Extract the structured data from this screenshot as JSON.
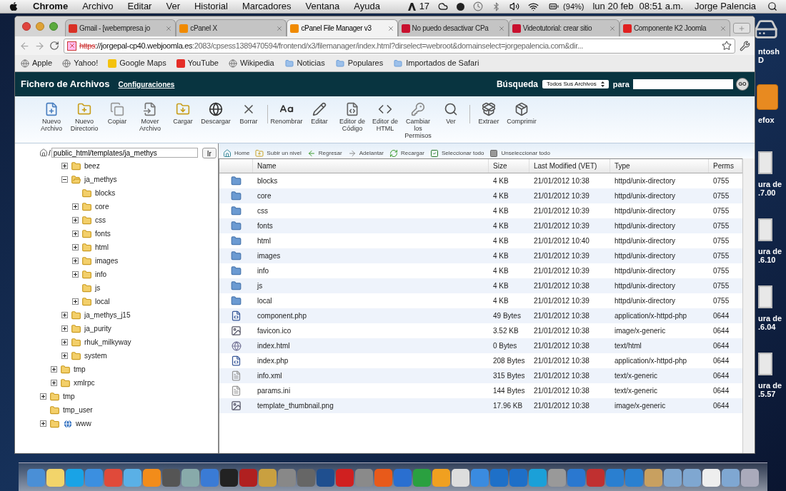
{
  "menubar": {
    "app": "Chrome",
    "menus": [
      "Archivo",
      "Editar",
      "Ver",
      "Historial",
      "Marcadores",
      "Ventana",
      "Ayuda"
    ],
    "adobe_count": "17",
    "battery": "(94%)",
    "date": "lun 20 feb",
    "time": "08:51 a.m.",
    "user": "Jorge Palencia"
  },
  "tabs": [
    {
      "title": "Gmail - [webempresa jo",
      "selected": false,
      "color": "#d93025"
    },
    {
      "title": "cPanel X",
      "selected": false,
      "color": "#f08a00"
    },
    {
      "title": "cPanel File Manager v3",
      "selected": true,
      "color": "#f08a00"
    },
    {
      "title": "No puedo desactivar CPa",
      "selected": false,
      "color": "#c8102e"
    },
    {
      "title": "Videotutorial: crear sitio",
      "selected": false,
      "color": "#c8102e"
    },
    {
      "title": "Componente K2 Joomla",
      "selected": false,
      "color": "#e02020"
    }
  ],
  "address": {
    "scheme": "https",
    "host": "://jorgepal-cp40.webjoomla.es",
    "path": ":2083/cpsess1389470594/frontend/x3/filemanager/index.html?dirselect=webroot&domainselect=jorgepalencia.com&dir..."
  },
  "bookmarks": [
    {
      "label": "Apple",
      "kind": "site"
    },
    {
      "label": "Yahoo!",
      "kind": "site"
    },
    {
      "label": "Google Maps",
      "kind": "app",
      "color": "#f4c20d"
    },
    {
      "label": "YouTube",
      "kind": "app",
      "color": "#e52d27"
    },
    {
      "label": "Wikipedia",
      "kind": "site"
    },
    {
      "label": "Noticias",
      "kind": "folder"
    },
    {
      "label": "Populares",
      "kind": "folder"
    },
    {
      "label": "Importados de Safari",
      "kind": "folder"
    }
  ],
  "header": {
    "title": "Fichero de Archivos",
    "settings_link": "Configuraciones",
    "search_label": "Búsqueda",
    "search_scope": "Todos Sus Archivos",
    "for_label": "para",
    "go": "GO"
  },
  "toolbar": [
    [
      "Nuevo Archivo",
      "Nuevo Directorio",
      "Copiar",
      "Mover Archivo",
      "Cargar",
      "Descargar",
      "Borrar"
    ],
    [
      "Renombrar",
      "Editar",
      "Editor de Código",
      "Editor de HTML",
      "Cambiar los Permisos",
      "Ver"
    ],
    [
      "Extraer",
      "Comprimir"
    ]
  ],
  "path": {
    "root": "/",
    "value": "public_html/templates/ja_methys",
    "go": "Ir"
  },
  "tree": [
    {
      "children": [
        {
          "children": [
            {
              "name": "beez",
              "expandable": true,
              "expanded": false,
              "kind": "folder"
            },
            {
              "name": "ja_methys",
              "expandable": true,
              "expanded": true,
              "kind": "folder",
              "children": [
                {
                  "name": "blocks",
                  "expandable": false,
                  "expanded": false,
                  "kind": "folder"
                },
                {
                  "name": "core",
                  "expandable": true,
                  "expanded": false,
                  "kind": "folder"
                },
                {
                  "name": "css",
                  "expandable": true,
                  "expanded": false,
                  "kind": "folder"
                },
                {
                  "name": "fonts",
                  "expandable": true,
                  "expanded": false,
                  "kind": "folder"
                },
                {
                  "name": "html",
                  "expandable": true,
                  "expanded": false,
                  "kind": "folder"
                },
                {
                  "name": "images",
                  "expandable": true,
                  "expanded": false,
                  "kind": "folder"
                },
                {
                  "name": "info",
                  "expandable": true,
                  "expanded": false,
                  "kind": "folder"
                },
                {
                  "name": "js",
                  "expandable": false,
                  "expanded": false,
                  "kind": "folder"
                },
                {
                  "name": "local",
                  "expandable": true,
                  "expanded": false,
                  "kind": "folder"
                }
              ]
            },
            {
              "name": "ja_methys_j15",
              "expandable": true,
              "expanded": false,
              "kind": "folder"
            },
            {
              "name": "ja_purity",
              "expandable": true,
              "expanded": false,
              "kind": "folder"
            },
            {
              "name": "rhuk_milkyway",
              "expandable": true,
              "expanded": false,
              "kind": "folder"
            },
            {
              "name": "system",
              "expandable": true,
              "expanded": false,
              "kind": "folder"
            }
          ]
        },
        {
          "name": "tmp",
          "expandable": true,
          "expanded": false,
          "kind": "folder"
        },
        {
          "name": "xmlrpc",
          "expandable": true,
          "expanded": false,
          "kind": "folder"
        }
      ]
    },
    {
      "name": "tmp",
      "expandable": true,
      "expanded": false,
      "kind": "folder"
    },
    {
      "name": "tmp_user",
      "expandable": false,
      "expanded": false,
      "kind": "folder"
    },
    {
      "name": "www",
      "expandable": true,
      "expanded": false,
      "kind": "web"
    }
  ],
  "navbar": [
    "Home",
    "Subir un nivel",
    "Regresar",
    "Adelantar",
    "Recargar",
    "Seleccionar todo",
    "Unseleccionar todo"
  ],
  "table": {
    "columns": [
      "Name",
      "Size",
      "Last Modified (VET)",
      "Type",
      "Perms"
    ],
    "rows": [
      {
        "kind": "folder",
        "name": "blocks",
        "size": "4 KB",
        "modified": "21/01/2012 10:38",
        "type": "httpd/unix-directory",
        "perms": "0755"
      },
      {
        "kind": "folder",
        "name": "core",
        "size": "4 KB",
        "modified": "21/01/2012 10:39",
        "type": "httpd/unix-directory",
        "perms": "0755"
      },
      {
        "kind": "folder",
        "name": "css",
        "size": "4 KB",
        "modified": "21/01/2012 10:39",
        "type": "httpd/unix-directory",
        "perms": "0755"
      },
      {
        "kind": "folder",
        "name": "fonts",
        "size": "4 KB",
        "modified": "21/01/2012 10:39",
        "type": "httpd/unix-directory",
        "perms": "0755"
      },
      {
        "kind": "folder",
        "name": "html",
        "size": "4 KB",
        "modified": "21/01/2012 10:40",
        "type": "httpd/unix-directory",
        "perms": "0755"
      },
      {
        "kind": "folder",
        "name": "images",
        "size": "4 KB",
        "modified": "21/01/2012 10:39",
        "type": "httpd/unix-directory",
        "perms": "0755"
      },
      {
        "kind": "folder",
        "name": "info",
        "size": "4 KB",
        "modified": "21/01/2012 10:39",
        "type": "httpd/unix-directory",
        "perms": "0755"
      },
      {
        "kind": "folder",
        "name": "js",
        "size": "4 KB",
        "modified": "21/01/2012 10:38",
        "type": "httpd/unix-directory",
        "perms": "0755"
      },
      {
        "kind": "folder",
        "name": "local",
        "size": "4 KB",
        "modified": "21/01/2012 10:39",
        "type": "httpd/unix-directory",
        "perms": "0755"
      },
      {
        "kind": "php",
        "name": "component.php",
        "size": "49 Bytes",
        "modified": "21/01/2012 10:38",
        "type": "application/x-httpd-php",
        "perms": "0644"
      },
      {
        "kind": "image",
        "name": "favicon.ico",
        "size": "3.52 KB",
        "modified": "21/01/2012 10:38",
        "type": "image/x-generic",
        "perms": "0644"
      },
      {
        "kind": "html",
        "name": "index.html",
        "size": "0 Bytes",
        "modified": "21/01/2012 10:38",
        "type": "text/html",
        "perms": "0644"
      },
      {
        "kind": "php",
        "name": "index.php",
        "size": "208 Bytes",
        "modified": "21/01/2012 10:38",
        "type": "application/x-httpd-php",
        "perms": "0644"
      },
      {
        "kind": "text",
        "name": "info.xml",
        "size": "315 Bytes",
        "modified": "21/01/2012 10:38",
        "type": "text/x-generic",
        "perms": "0644"
      },
      {
        "kind": "text",
        "name": "params.ini",
        "size": "144 Bytes",
        "modified": "21/01/2012 10:38",
        "type": "text/x-generic",
        "perms": "0644"
      },
      {
        "kind": "image",
        "name": "template_thumbnail.png",
        "size": "17.96 KB",
        "modified": "21/01/2012 10:38",
        "type": "image/x-generic",
        "perms": "0644"
      }
    ]
  },
  "desktop_icons": [
    {
      "kind": "drive",
      "lines": [
        "ntosh",
        "D"
      ]
    },
    {
      "kind": "app",
      "lines": [
        "efox"
      ]
    },
    {
      "kind": "disk",
      "lines": [
        "ura de",
        ".7.00"
      ]
    },
    {
      "kind": "disk",
      "lines": [
        "ura de",
        ".6.10"
      ]
    },
    {
      "kind": "disk",
      "lines": [
        "ura de",
        ".6.04"
      ]
    },
    {
      "kind": "disk",
      "lines": [
        "ura de",
        ".5.57"
      ]
    }
  ],
  "dock": [
    {
      "color": "#4a8fd6"
    },
    {
      "color": "#f2d46a"
    },
    {
      "color": "#19a3e6"
    },
    {
      "color": "#3b8fe0"
    },
    {
      "color": "#e04a3a"
    },
    {
      "color": "#5ab0e6"
    },
    {
      "color": "#f28c1a"
    },
    {
      "color": "#555555"
    },
    {
      "color": "#88aaaa"
    },
    {
      "color": "#3a7bd5"
    },
    {
      "color": "#222222"
    },
    {
      "color": "#b02020"
    },
    {
      "color": "#c9a040"
    },
    {
      "color": "#888888"
    },
    {
      "color": "#666666"
    },
    {
      "color": "#1f4f8f"
    },
    {
      "color": "#d02020"
    },
    {
      "color": "#8a8a8a"
    },
    {
      "color": "#e85a1a"
    },
    {
      "color": "#2a6fd0"
    },
    {
      "color": "#2aa040"
    },
    {
      "color": "#f0a020"
    },
    {
      "color": "#dddddd"
    },
    {
      "color": "#3a8be0"
    },
    {
      "color": "#1e70c8"
    },
    {
      "color": "#1e6fc8"
    },
    {
      "color": "#1ba0d8"
    },
    {
      "color": "#999999"
    },
    {
      "color": "#2a78d0"
    },
    {
      "color": "#c03030"
    },
    {
      "color": "#2a7fd0"
    },
    {
      "color": "#2a80d0"
    },
    {
      "color": "#c8a060"
    },
    {
      "color": "#7fa7d0"
    },
    {
      "color": "#7fa7d1"
    },
    {
      "color": "#eeeeee"
    },
    {
      "color": "#7fa7d2"
    },
    {
      "color": "#aaaabb"
    }
  ]
}
